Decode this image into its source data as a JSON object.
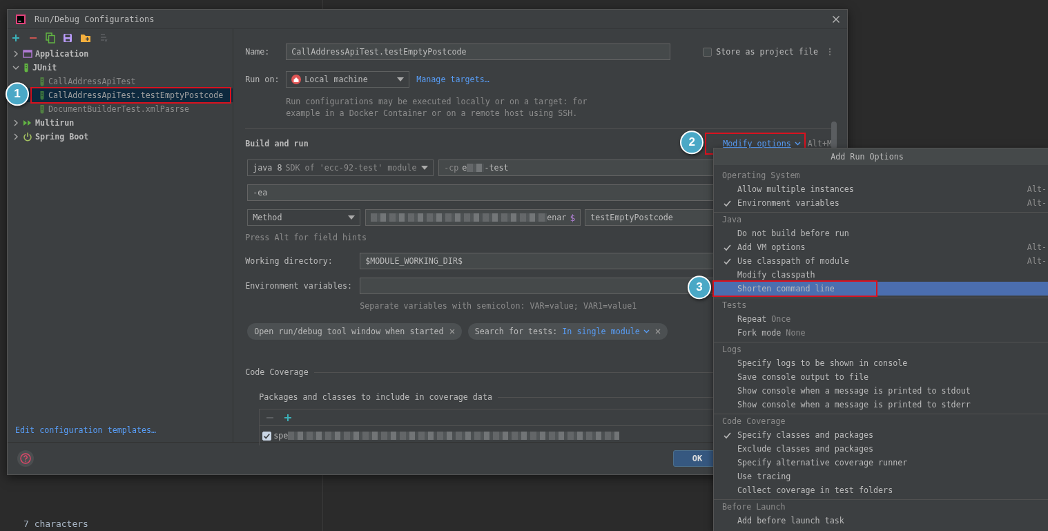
{
  "editor": {
    "lines": [
      "7 characters"
    ]
  },
  "dialog": {
    "title": "Run/Debug Configurations",
    "toolbar": [
      {
        "kind": "add",
        "disabled": false
      },
      {
        "kind": "remove",
        "disabled": false
      },
      {
        "kind": "copy",
        "disabled": false
      },
      {
        "kind": "save",
        "disabled": false
      },
      {
        "kind": "folder",
        "disabled": false
      },
      {
        "kind": "sort",
        "disabled": true
      }
    ],
    "tree": [
      {
        "label": "Application",
        "kind": "application",
        "expanded": false,
        "selected": false
      },
      {
        "label": "JUnit",
        "kind": "junit",
        "expanded": true,
        "selected": false,
        "children": [
          {
            "label": "CallAddressApiTest",
            "kind": "test",
            "temporary": true,
            "selected": false
          },
          {
            "label": "CallAddressApiTest.testEmptyPostcode",
            "kind": "test",
            "temporary": true,
            "selected": true,
            "marker": "1"
          },
          {
            "label": "DocumentBuilderTest.xmlPasrse",
            "kind": "test",
            "temporary": true,
            "selected": false
          }
        ]
      },
      {
        "label": "Multirun",
        "kind": "multirun",
        "expanded": false,
        "selected": false
      },
      {
        "label": "Spring Boot",
        "kind": "spring",
        "expanded": false,
        "selected": false
      }
    ],
    "templates_link": "Edit configuration templates…",
    "form": {
      "name": {
        "label": "Name:",
        "value": "CallAddressApiTest.testEmptyPostcode"
      },
      "store_as_project_file": {
        "label": "Store as project file",
        "checked": false
      },
      "run_on": {
        "label": "Run on:",
        "value": "Local machine",
        "link": "Manage targets…",
        "description": "Run configurations may be executed locally or on a target: for example in a Docker Container or on a remote host using SSH."
      },
      "build": {
        "title": "Build and run",
        "modify_options": {
          "label": "Modify options",
          "marker": "2"
        },
        "shortcut": "Alt+M",
        "jre": {
          "value": "java 8",
          "detail": "SDK of 'ecc-92-test' module"
        },
        "classpath": {
          "hint": "-cp",
          "value_start": "e",
          "value_end": "-test"
        },
        "vm_options": "-ea",
        "test_kind": "Method",
        "class_field": {
          "value_end": "enar",
          "icon": "$"
        },
        "method": "testEmptyPostcode",
        "hint": "Press Alt for field hints"
      },
      "working_directory": {
        "label": "Working directory:",
        "value": "$MODULE_WORKING_DIR$"
      },
      "environment_variables": {
        "label": "Environment variables:",
        "hint": "Separate variables with semicolon: VAR=value; VAR1=value1"
      },
      "chips": [
        {
          "label": "Open run/debug tool window when started"
        },
        {
          "label": "Search for tests:",
          "value": "In single module"
        }
      ],
      "coverage": {
        "title": "Code Coverage",
        "subtitle": "Packages and classes to include in coverage data",
        "toolbar": [
          {
            "kind": "remove",
            "disabled": true
          },
          {
            "kind": "add",
            "disabled": false
          }
        ],
        "rows": [
          {
            "checked": true,
            "value_start": "spe"
          }
        ]
      }
    },
    "ok_button": "OK"
  },
  "popup": {
    "title": "Add Run Options",
    "groups": [
      {
        "label": "Operating System",
        "items": [
          {
            "label": "Allow multiple instances",
            "checked": false,
            "shortcut": "Alt-",
            "selected": false
          },
          {
            "label": "Environment variables",
            "checked": true,
            "shortcut": "Alt-",
            "selected": false
          }
        ]
      },
      {
        "label": "Java",
        "items": [
          {
            "label": "Do not build before run",
            "checked": false,
            "selected": false
          },
          {
            "label": "Add VM options",
            "checked": true,
            "shortcut": "Alt-",
            "selected": false
          },
          {
            "label": "Use classpath of module",
            "checked": true,
            "shortcut": "Alt-",
            "selected": false
          },
          {
            "label": "Modify classpath",
            "checked": false,
            "selected": false
          },
          {
            "label": "Shorten command line",
            "checked": false,
            "selected": true,
            "marker": "3"
          }
        ]
      },
      {
        "label": "Tests",
        "items": [
          {
            "label": "Repeat",
            "value": "Once",
            "checked": false,
            "selected": false
          },
          {
            "label": "Fork mode",
            "value": "None",
            "checked": false,
            "selected": false
          }
        ]
      },
      {
        "label": "Logs",
        "items": [
          {
            "label": "Specify logs to be shown in console",
            "checked": false,
            "selected": false
          },
          {
            "label": "Save console output to file",
            "checked": false,
            "selected": false
          },
          {
            "label": "Show console when a message is printed to stdout",
            "checked": false,
            "selected": false
          },
          {
            "label": "Show console when a message is printed to stderr",
            "checked": false,
            "selected": false
          }
        ]
      },
      {
        "label": "Code Coverage",
        "items": [
          {
            "label": "Specify classes and packages",
            "checked": true,
            "selected": false
          },
          {
            "label": "Exclude classes and packages",
            "checked": false,
            "selected": false
          },
          {
            "label": "Specify alternative coverage runner",
            "checked": false,
            "selected": false
          },
          {
            "label": "Use tracing",
            "checked": false,
            "selected": false
          },
          {
            "label": "Collect coverage in test folders",
            "checked": false,
            "selected": false
          }
        ]
      },
      {
        "label": "Before Launch",
        "items": [
          {
            "label": "Add before launch task",
            "checked": false,
            "selected": false
          }
        ]
      }
    ]
  }
}
